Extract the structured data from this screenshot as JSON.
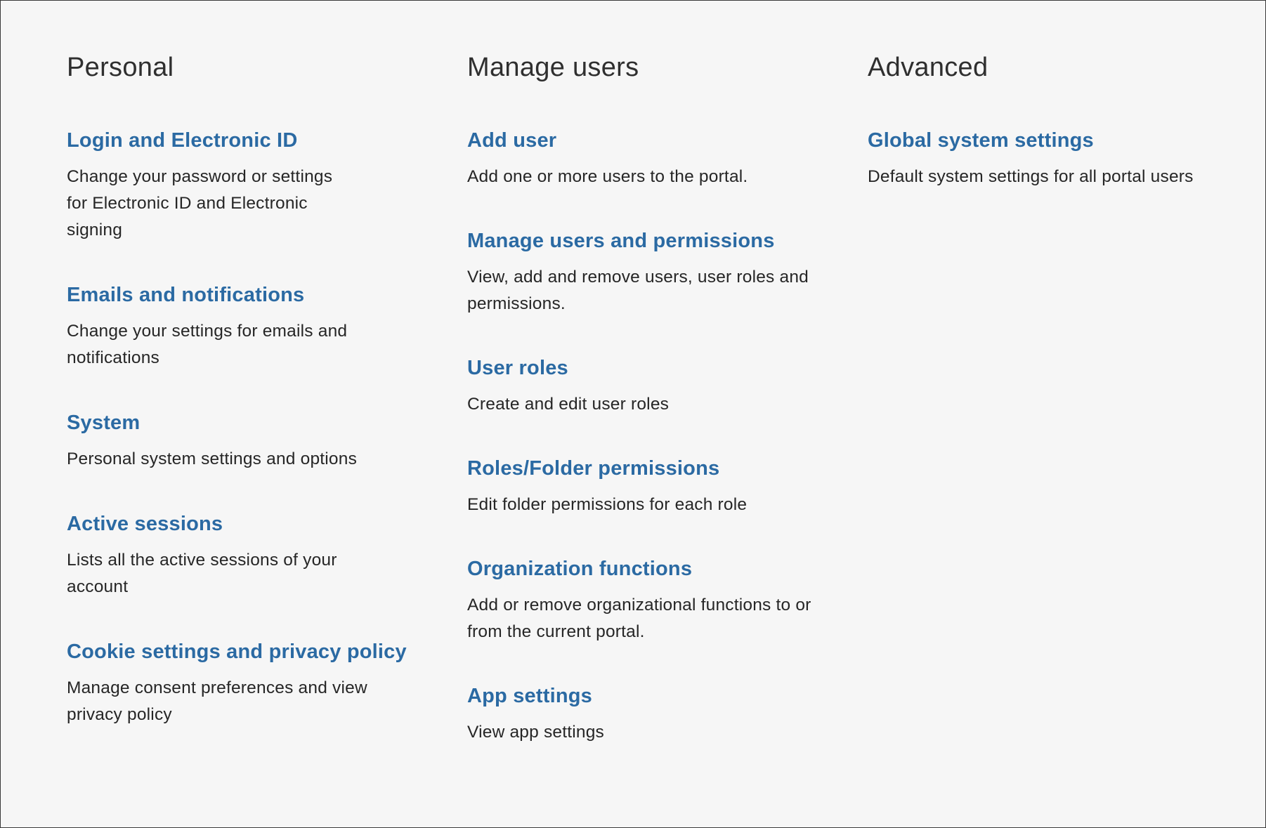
{
  "personal": {
    "title": "Personal",
    "items": [
      {
        "label": "Login and Electronic ID",
        "description": "Change your password or settings for Electronic ID and Electronic signing"
      },
      {
        "label": "Emails and notifications",
        "description": "Change your settings for emails and notifications"
      },
      {
        "label": "System",
        "description": "Personal system settings and options"
      },
      {
        "label": "Active sessions",
        "description": "Lists all the active sessions of your account"
      },
      {
        "label": "Cookie settings and privacy policy",
        "description": "Manage consent preferences and view privacy policy"
      }
    ]
  },
  "manage_users": {
    "title": "Manage users",
    "items": [
      {
        "label": "Add user",
        "description": "Add one or more users to the portal."
      },
      {
        "label": "Manage users and permissions",
        "description": "View, add and remove users, user roles and permissions."
      },
      {
        "label": "User roles",
        "description": "Create and edit user roles"
      },
      {
        "label": "Roles/Folder permissions",
        "description": "Edit folder permissions for each role"
      },
      {
        "label": "Organization functions",
        "description": "Add or remove organizational functions to or from the current portal."
      },
      {
        "label": "App settings",
        "description": "View app settings"
      }
    ]
  },
  "advanced": {
    "title": "Advanced",
    "items": [
      {
        "label": "Global system settings",
        "description": "Default system settings for all portal users"
      }
    ]
  },
  "colors": {
    "link": "#2b6aa3",
    "text": "#262626",
    "background": "#f6f6f6"
  }
}
